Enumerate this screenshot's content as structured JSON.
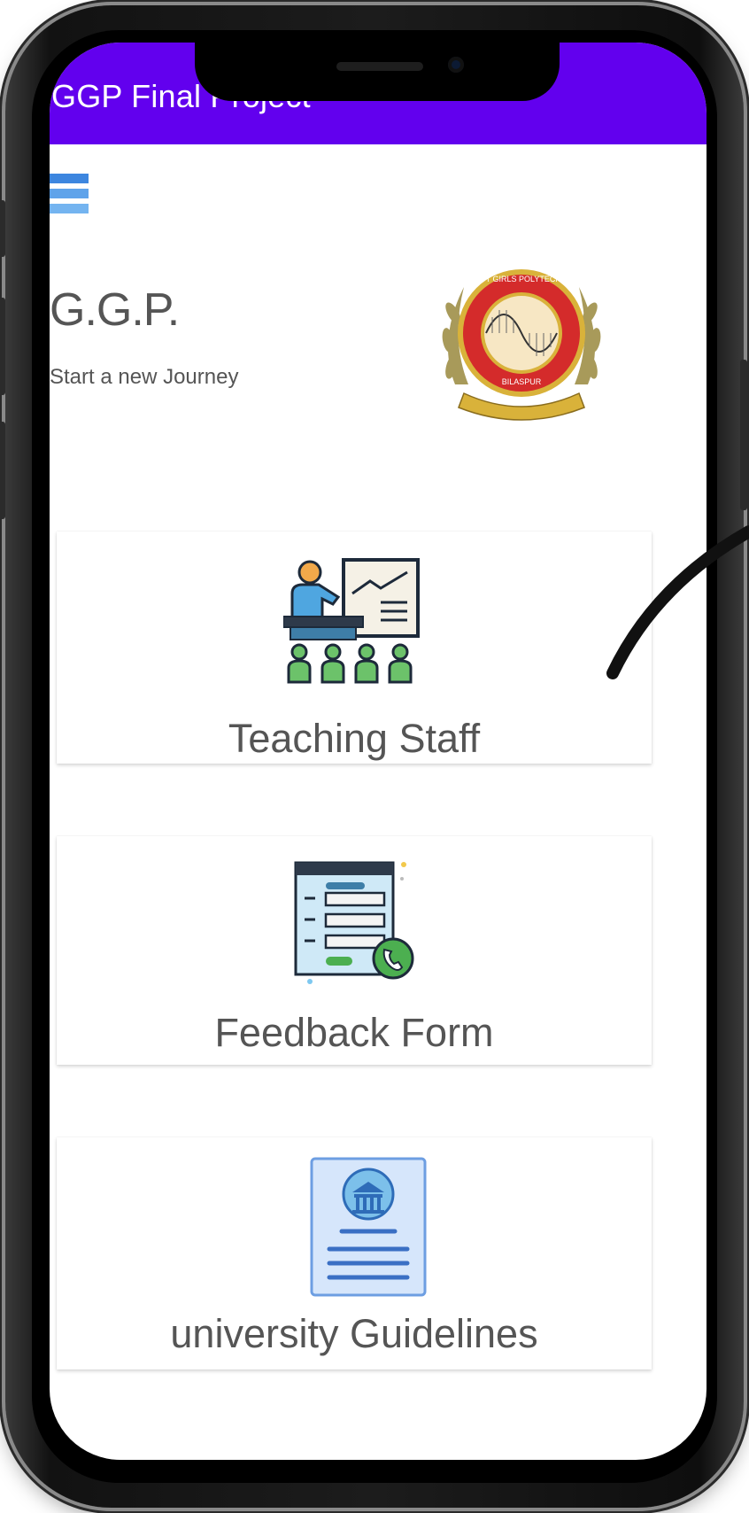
{
  "appbar": {
    "title": "GGP Final Project"
  },
  "header": {
    "title": "G.G.P.",
    "subtitle": "Start a new Journey"
  },
  "cards": [
    {
      "label": "Teaching Staff"
    },
    {
      "label": "Feedback Form"
    },
    {
      "label": "university Guidelines"
    }
  ],
  "logo": {
    "ring_text": "GOVERNMENT GIRLS POLYTECHNIC",
    "city": "BILASPUR"
  },
  "colors": {
    "appbar": "#6200ee",
    "menu": "#4a90e2",
    "text": "#555555"
  }
}
